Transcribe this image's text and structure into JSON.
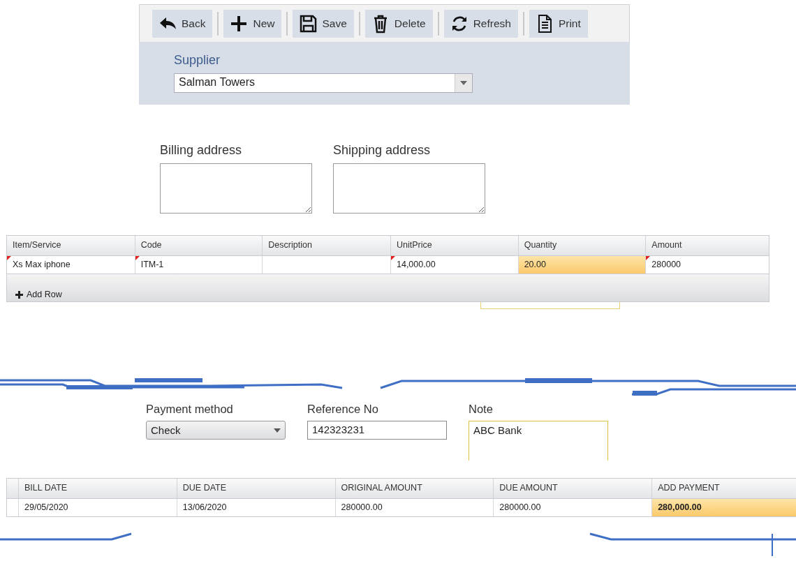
{
  "toolbar": {
    "buttons": [
      {
        "label": "Back"
      },
      {
        "label": "New"
      },
      {
        "label": "Save"
      },
      {
        "label": "Delete"
      },
      {
        "label": "Refresh"
      },
      {
        "label": "Print"
      }
    ]
  },
  "supplier": {
    "label": "Supplier",
    "value": "Salman Towers"
  },
  "addresses": [
    {
      "label": "Billing address"
    },
    {
      "label": "Shipping address"
    }
  ],
  "items_grid": {
    "columns": [
      "Item/Service",
      "Code",
      "Description",
      "UnitPrice",
      "Quantity",
      "Amount"
    ],
    "rows": [
      {
        "cells": [
          {
            "text": "Xs Max iphone",
            "flagged": true,
            "selected": false
          },
          {
            "text": "ITM-1",
            "flagged": true,
            "selected": false
          },
          {
            "flagged": false,
            "selected": false
          },
          {
            "text": "14,000.00",
            "flagged": true,
            "selected": false
          },
          {
            "text": "20.00",
            "flagged": false,
            "selected": true
          },
          {
            "text": "280000",
            "flagged": true,
            "selected": false
          }
        ]
      }
    ],
    "add_row": "Add Row"
  },
  "payment": {
    "method": {
      "label": "Payment method",
      "value": "Check"
    },
    "reference": {
      "label": "Reference No",
      "value": "142323231"
    },
    "note": {
      "label": "Note",
      "value": "ABC Bank"
    }
  },
  "bills_grid": {
    "columns": [
      "BILL DATE",
      "DUE DATE",
      "ORIGINAL AMOUNT",
      "DUE AMOUNT",
      "ADD PAYMENT"
    ],
    "rows": [
      {
        "cells": [
          {
            "text": "29/05/2020",
            "selected": false
          },
          {
            "text": "13/06/2020",
            "selected": false
          },
          {
            "text": "280000.00",
            "selected": false
          },
          {
            "text": "280000.00",
            "selected": false
          },
          {
            "text": "280,000.00",
            "selected": true
          }
        ]
      }
    ]
  }
}
